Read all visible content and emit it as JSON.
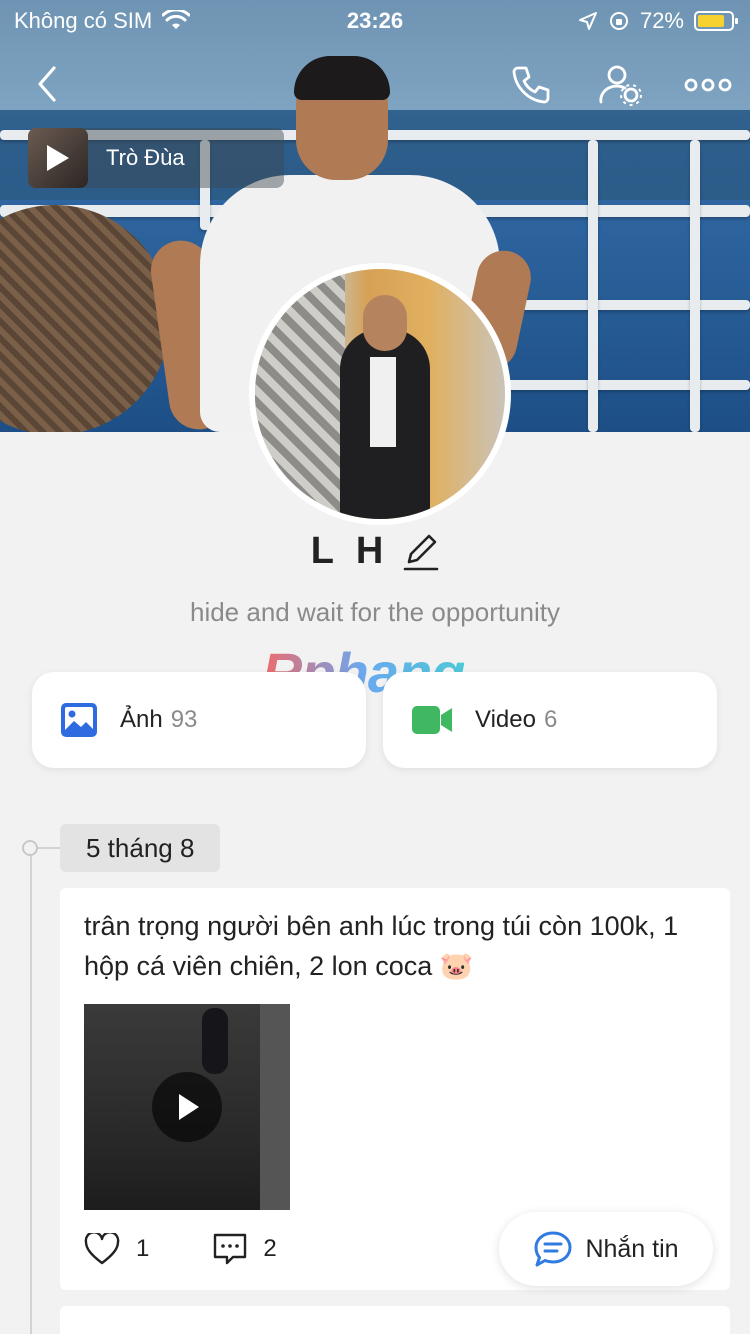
{
  "status_bar": {
    "carrier": "Không có SIM",
    "time": "23:26",
    "battery": "72%",
    "battery_level": 0.72
  },
  "nav": {
    "back_icon": "chevron-left-icon",
    "call_icon": "phone-icon",
    "settings_icon": "user-settings-icon",
    "more_icon": "more-icon"
  },
  "music": {
    "title": "Trò Đùa"
  },
  "profile": {
    "name": "L H",
    "bio": "hide and wait for the opportunity"
  },
  "watermark": "Rphang",
  "media": {
    "photos_label": "Ảnh",
    "photos_count": "93",
    "videos_label": "Video",
    "videos_count": "6"
  },
  "timeline": {
    "date": "5 tháng 8",
    "post": {
      "text": "trân trọng người bên anh lúc trong túi còn 100k, 1 hộp cá viên chiên, 2 lon coca 🐷",
      "likes": "1",
      "comments": "2"
    }
  },
  "message_button": "Nhắn tin",
  "colors": {
    "photo_icon": "#2f6be0",
    "video_icon": "#3fb861",
    "message_icon": "#2f7be0"
  }
}
